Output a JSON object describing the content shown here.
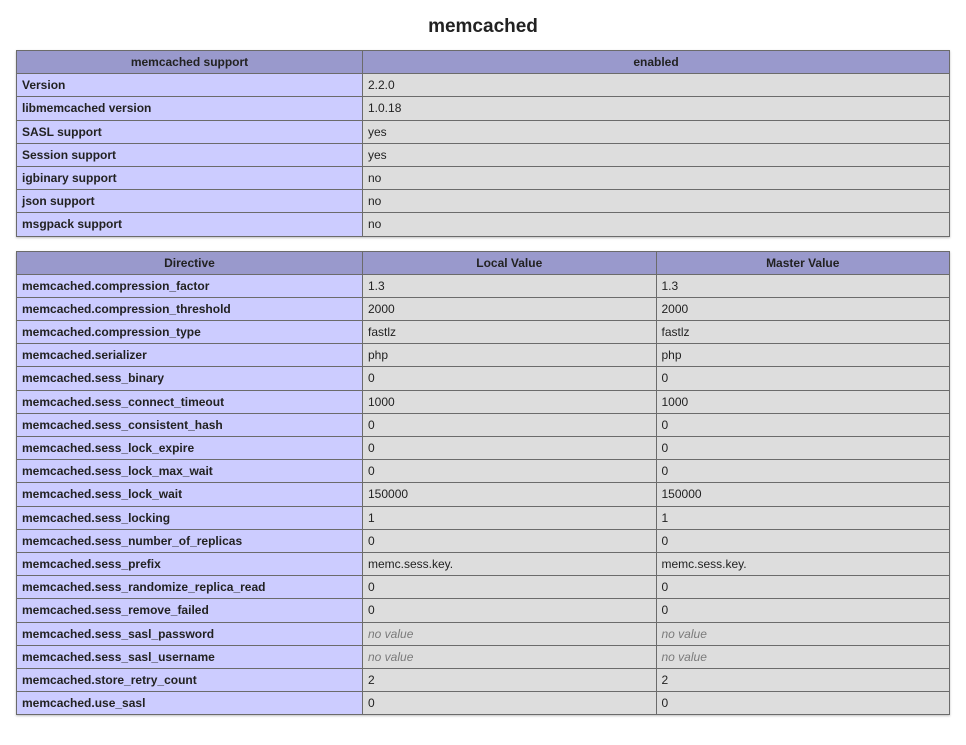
{
  "title": "memcached",
  "support_table": {
    "headers": [
      "memcached support",
      "enabled"
    ],
    "rows": [
      {
        "label": "Version",
        "value": "2.2.0"
      },
      {
        "label": "libmemcached version",
        "value": "1.0.18"
      },
      {
        "label": "SASL support",
        "value": "yes"
      },
      {
        "label": "Session support",
        "value": "yes"
      },
      {
        "label": "igbinary support",
        "value": "no"
      },
      {
        "label": "json support",
        "value": "no"
      },
      {
        "label": "msgpack support",
        "value": "no"
      }
    ]
  },
  "directive_table": {
    "headers": [
      "Directive",
      "Local Value",
      "Master Value"
    ],
    "no_value_text": "no value",
    "rows": [
      {
        "directive": "memcached.compression_factor",
        "local": "1.3",
        "master": "1.3"
      },
      {
        "directive": "memcached.compression_threshold",
        "local": "2000",
        "master": "2000"
      },
      {
        "directive": "memcached.compression_type",
        "local": "fastlz",
        "master": "fastlz"
      },
      {
        "directive": "memcached.serializer",
        "local": "php",
        "master": "php"
      },
      {
        "directive": "memcached.sess_binary",
        "local": "0",
        "master": "0"
      },
      {
        "directive": "memcached.sess_connect_timeout",
        "local": "1000",
        "master": "1000"
      },
      {
        "directive": "memcached.sess_consistent_hash",
        "local": "0",
        "master": "0"
      },
      {
        "directive": "memcached.sess_lock_expire",
        "local": "0",
        "master": "0"
      },
      {
        "directive": "memcached.sess_lock_max_wait",
        "local": "0",
        "master": "0"
      },
      {
        "directive": "memcached.sess_lock_wait",
        "local": "150000",
        "master": "150000"
      },
      {
        "directive": "memcached.sess_locking",
        "local": "1",
        "master": "1"
      },
      {
        "directive": "memcached.sess_number_of_replicas",
        "local": "0",
        "master": "0"
      },
      {
        "directive": "memcached.sess_prefix",
        "local": "memc.sess.key.",
        "master": "memc.sess.key."
      },
      {
        "directive": "memcached.sess_randomize_replica_read",
        "local": "0",
        "master": "0"
      },
      {
        "directive": "memcached.sess_remove_failed",
        "local": "0",
        "master": "0"
      },
      {
        "directive": "memcached.sess_sasl_password",
        "local": null,
        "master": null
      },
      {
        "directive": "memcached.sess_sasl_username",
        "local": null,
        "master": null
      },
      {
        "directive": "memcached.store_retry_count",
        "local": "2",
        "master": "2"
      },
      {
        "directive": "memcached.use_sasl",
        "local": "0",
        "master": "0"
      }
    ]
  }
}
